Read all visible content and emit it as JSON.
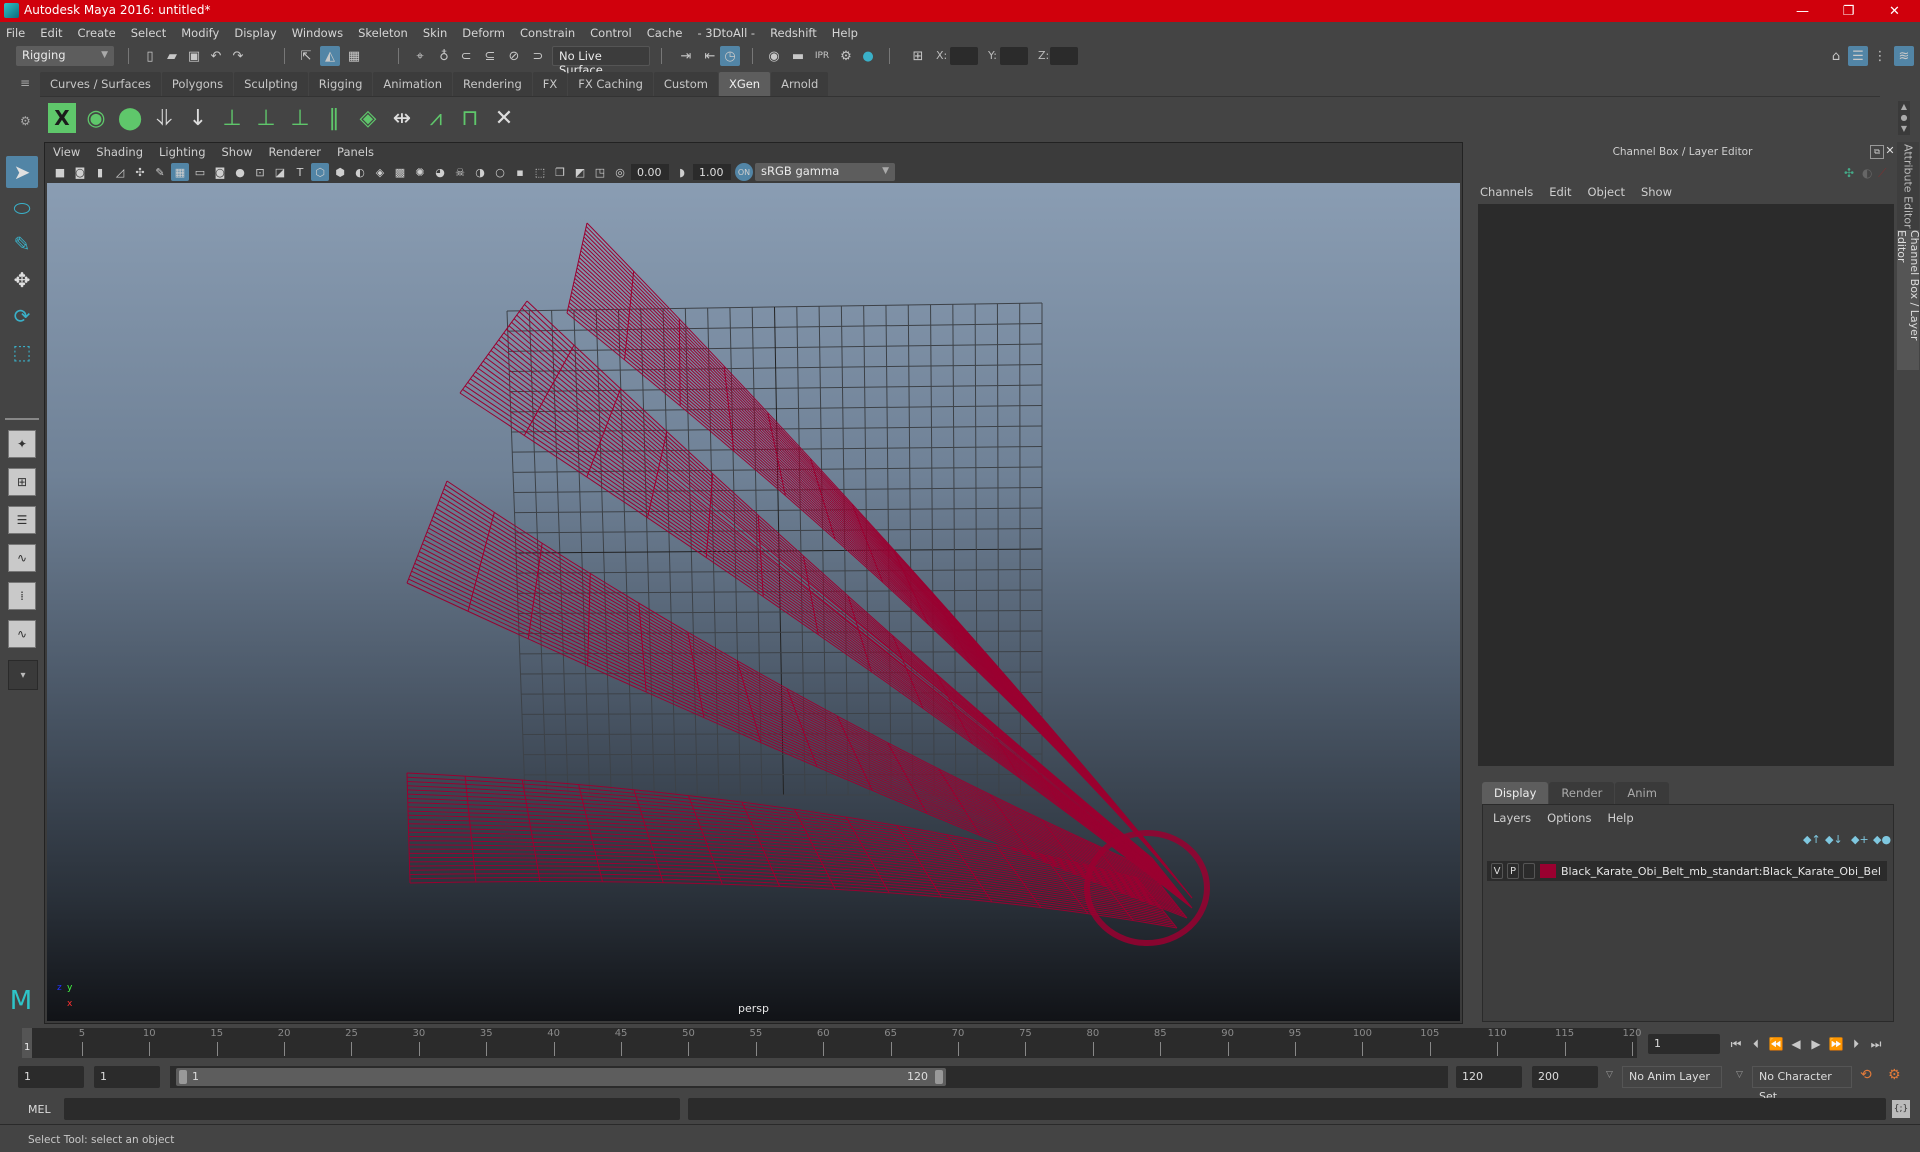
{
  "window": {
    "title": "Autodesk Maya 2016: untitled*",
    "controls": {
      "minimize": "—",
      "maximize": "❐",
      "close": "✕"
    }
  },
  "menubar": [
    "File",
    "Edit",
    "Create",
    "Select",
    "Modify",
    "Display",
    "Windows",
    "Skeleton",
    "Skin",
    "Deform",
    "Constrain",
    "Control",
    "Cache",
    "- 3DtoAll -",
    "Redshift",
    "Help"
  ],
  "statusline": {
    "menuset": "Rigging",
    "live_surface": "No Live Surface",
    "x_label": "X:",
    "y_label": "Y:",
    "z_label": "Z:",
    "x_value": "",
    "y_value": "",
    "z_value": ""
  },
  "shelf": {
    "tabs": [
      "Curves / Surfaces",
      "Polygons",
      "Sculpting",
      "Rigging",
      "Animation",
      "Rendering",
      "FX",
      "FX Caching",
      "Custom",
      "XGen",
      "Arnold"
    ],
    "active_tab": "XGen",
    "icons": [
      "xgen-editor-icon",
      "create-description-icon",
      "delete-description-icon",
      "add-guide-icon",
      "place-guide-icon",
      "add-spline-icon",
      "guide-visibility-icon",
      "lock-guide-icon",
      "rebuild-guide-icon",
      "toggle-patch-icon",
      "sculpt-guide-icon",
      "select-guides-icon",
      "bound-guides-icon",
      "delete-guides-icon"
    ]
  },
  "viewport": {
    "menus": [
      "View",
      "Shading",
      "Lighting",
      "Show",
      "Renderer",
      "Panels"
    ],
    "exposure": "0.00",
    "gamma": "1.00",
    "color_space": "sRGB gamma",
    "camera_label": "persp",
    "axis": {
      "x": "x",
      "y": "y",
      "z": "z"
    },
    "wire_color": "#9a0030"
  },
  "channel_box": {
    "header": "Channel Box / Layer Editor",
    "menus": [
      "Channels",
      "Edit",
      "Object",
      "Show"
    ]
  },
  "layer_editor": {
    "tabs": [
      "Display",
      "Render",
      "Anim"
    ],
    "active_tab": "Display",
    "menus": [
      "Layers",
      "Options",
      "Help"
    ],
    "layers": [
      {
        "v": "V",
        "p": "P",
        "color": "#9a0030",
        "name": "Black_Karate_Obi_Belt_mb_standart:Black_Karate_Obi_Bel"
      }
    ]
  },
  "side_tabs": [
    "Attribute Editor",
    "Channel Box / Layer Editor"
  ],
  "timeline": {
    "current_frame_marker": "1",
    "ticks": [
      5,
      10,
      15,
      20,
      25,
      30,
      35,
      40,
      45,
      50,
      55,
      60,
      65,
      70,
      75,
      80,
      85,
      90,
      95,
      100,
      105,
      110,
      115,
      120
    ],
    "current_frame": "1",
    "range_start": "1",
    "playback_start": "1",
    "range_slider_start": "1",
    "range_slider_end": "120",
    "playback_end": "120",
    "range_end": "200",
    "anim_layer": "No Anim Layer",
    "character_set": "No Character Set"
  },
  "command_line": {
    "language": "MEL",
    "input": "",
    "result": ""
  },
  "help_line": "Select Tool: select an object"
}
